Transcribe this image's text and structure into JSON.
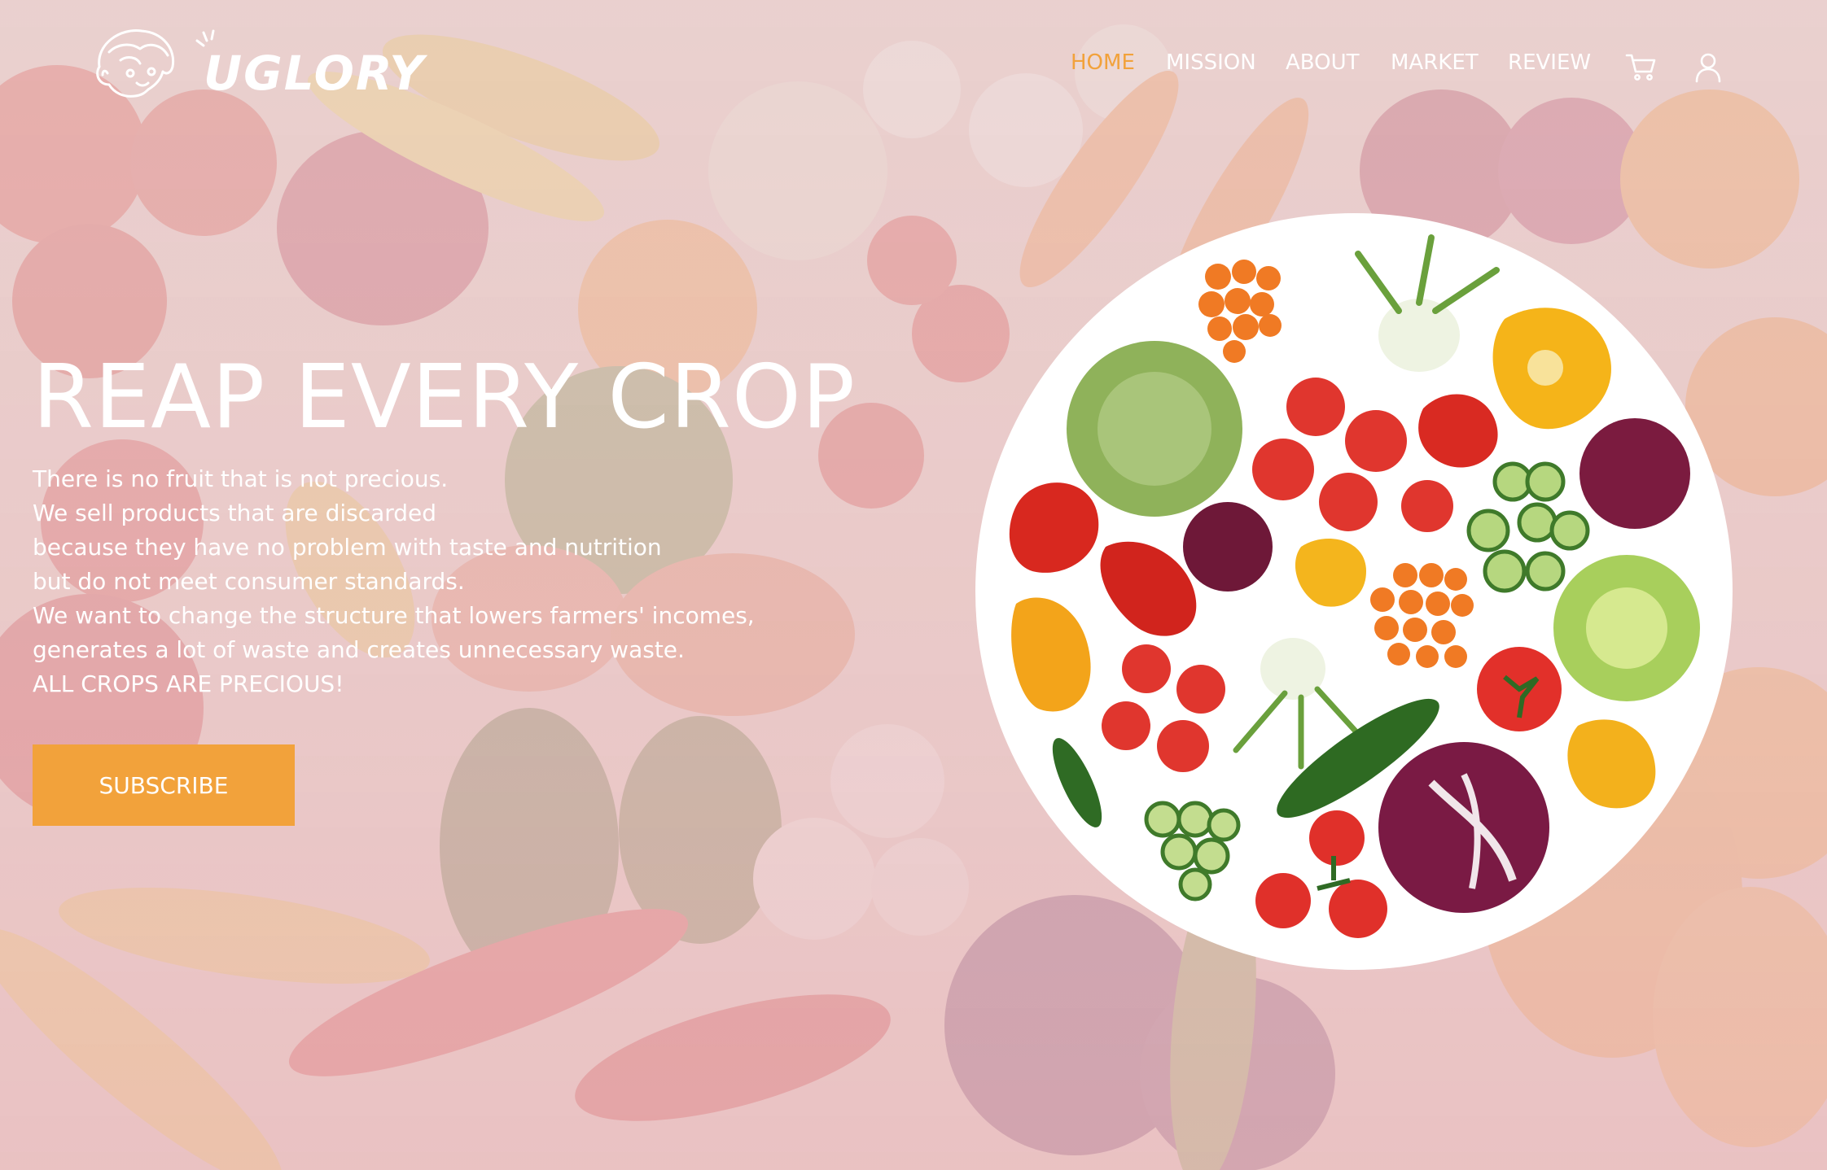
{
  "brand": {
    "name": "UGLORY",
    "logo_icon": "cartoon-face-icon"
  },
  "nav": {
    "items": [
      {
        "label": "HOME",
        "active": true
      },
      {
        "label": "MISSION",
        "active": false
      },
      {
        "label": "ABOUT",
        "active": false
      },
      {
        "label": "MARKET",
        "active": false
      },
      {
        "label": "REVIEW",
        "active": false
      }
    ],
    "icons": [
      "cart-icon",
      "user-icon"
    ]
  },
  "hero": {
    "headline": "REAP EVERY CROP",
    "lines": [
      "There is no fruit that is not precious.",
      "We sell products that are discarded",
      "because they have no problem with taste and nutrition",
      "but do not meet consumer standards.",
      "We want to change the structure that lowers farmers' incomes,",
      "generates a lot of waste and creates unnecessary waste.",
      "ALL CROPS ARE PRECIOUS!"
    ],
    "cta_label": "SUBSCRIBE"
  },
  "colors": {
    "accent": "#f2a23b",
    "text": "#ffffff",
    "overlay": "#ecd0d4"
  }
}
